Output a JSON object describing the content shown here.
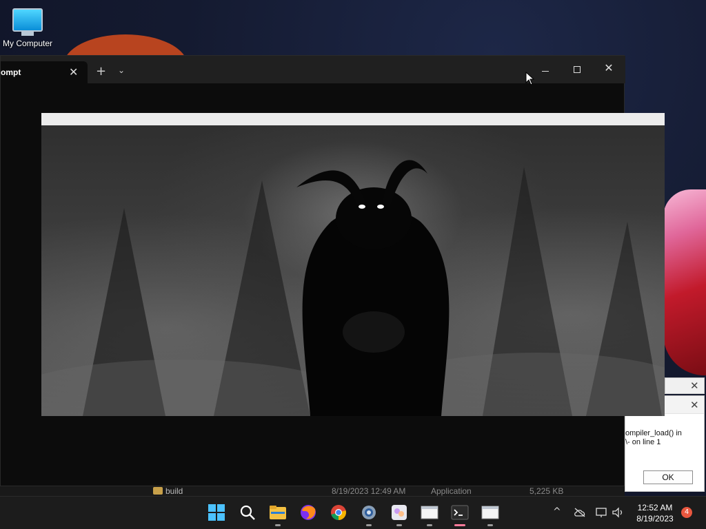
{
  "desktop": {
    "icons": [
      {
        "label": "My Computer",
        "icon": "monitor-icon"
      }
    ]
  },
  "terminal": {
    "tab_label": "ompt",
    "new_tab": "+",
    "dropdown": "⌄",
    "close_glyph": "✕"
  },
  "explorer_row": {
    "name": "build",
    "date": "8/19/2023 12:49 AM",
    "type": "Application",
    "size": "5,225 KB"
  },
  "dialog": {
    "message_line1": "ompiler_load() in",
    "message_line2": "\\- on line 1",
    "ok_label": "OK"
  },
  "taskbar": {
    "apps": [
      "start-icon",
      "search-icon",
      "file-explorer-icon",
      "firefox-icon",
      "chrome-icon",
      "settings-icon",
      "paint-icon",
      "window-icon",
      "terminal-icon",
      "window-icon-2"
    ],
    "time": "12:52 AM",
    "date": "8/19/2023",
    "notification_count": "4"
  },
  "colors": {
    "accent": "#ff7a9a",
    "badge": "#e9573f"
  }
}
